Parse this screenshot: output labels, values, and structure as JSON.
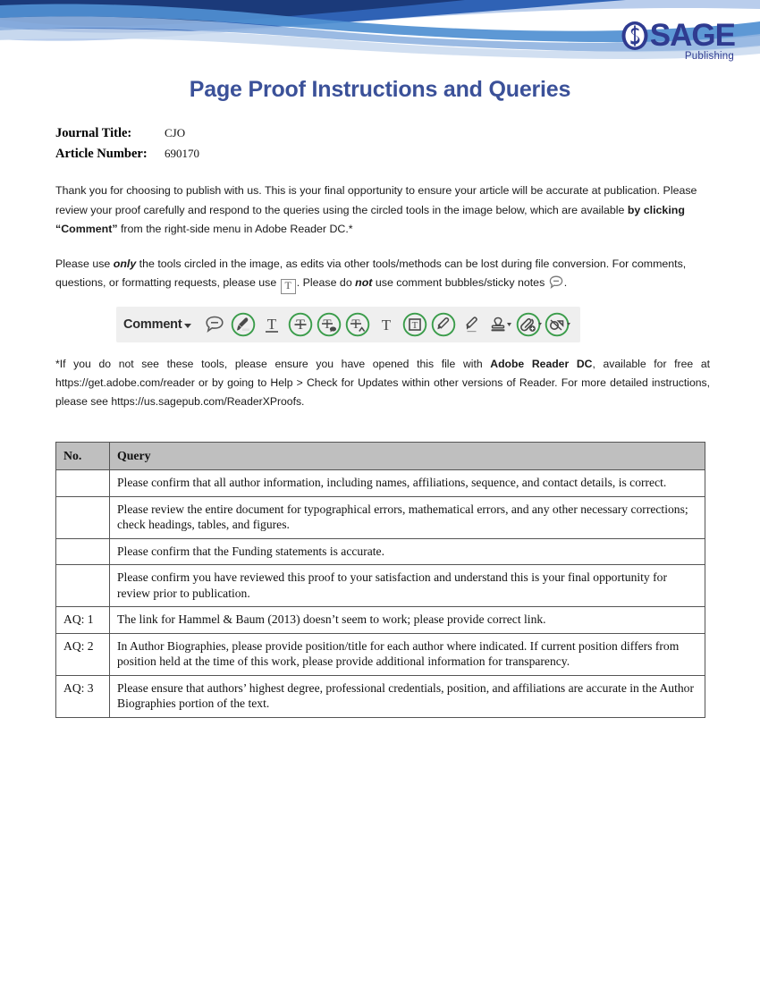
{
  "header": {
    "logo": {
      "word": "SAGE",
      "sub": "Publishing",
      "emblem_letter": "S",
      "color": "#2f3b90"
    },
    "banner_colors": [
      "#1b3a7a",
      "#2f62b5",
      "#4f8fd1",
      "#8fb3e0",
      "#b9cdec"
    ]
  },
  "title": "Page Proof Instructions and Queries",
  "title_color": "#3b5199",
  "meta": [
    {
      "label": "Journal Title:",
      "value": "CJO"
    },
    {
      "label": "Article Number:",
      "value": "690170"
    }
  ],
  "paragraph1": {
    "text_a": "Thank you for choosing to publish with us. This is your final opportunity to ensure your article will be accurate at publication. Please review your proof carefully and respond to the queries using the circled tools in the image below, which are available ",
    "bold_b": "by clicking “Comment”",
    "text_c": " from the right-side menu in Adobe Reader DC.*"
  },
  "paragraph2": {
    "text_a": "Please use ",
    "italic_b": "only",
    "text_c": " the tools circled in the image, as edits via other tools/methods can be lost during file conversion. For comments, questions, or formatting requests, please use ",
    "icon_tbox": "T",
    "text_d": ".  Please do ",
    "italic_e": "not",
    "text_f": " use comment bubbles/sticky notes ",
    "text_g": "."
  },
  "toolbar": {
    "label": "Comment",
    "caret": "dropdown-caret",
    "background": "#efefef",
    "ring_color": "#3a9c4a",
    "icon_color": "#4a4a4a",
    "tools": [
      {
        "name": "sticky-note-icon",
        "circled": false
      },
      {
        "name": "highlight-text-icon",
        "circled": true
      },
      {
        "name": "underline-text-icon",
        "circled": false
      },
      {
        "name": "strikethrough-text-icon",
        "circled": true
      },
      {
        "name": "replace-text-icon",
        "circled": true
      },
      {
        "name": "insert-text-icon",
        "circled": true
      },
      {
        "name": "add-text-icon",
        "circled": false
      },
      {
        "name": "text-box-icon",
        "circled": true
      },
      {
        "name": "draw-pencil-icon",
        "circled": true
      },
      {
        "name": "eraser-icon",
        "circled": false
      },
      {
        "name": "stamp-icon",
        "circled": false
      },
      {
        "name": "attach-file-icon",
        "circled": true
      },
      {
        "name": "drawing-tools-icon",
        "circled": true
      }
    ]
  },
  "footnote": {
    "text_a": "*If you do not see these tools, please ensure you have opened this file with ",
    "bold_b": "Adobe Reader DC",
    "text_c": ", available for free at https://get.adobe.com/reader or by going to Help > Check for Updates within other versions of Reader. For more detailed instructions, please see https://us.sagepub.com/ReaderXProofs."
  },
  "table": {
    "headers": [
      "No.",
      "Query"
    ],
    "rows": [
      {
        "no": "",
        "query": "Please confirm that all author information, including names, affiliations, sequence, and contact details, is correct."
      },
      {
        "no": "",
        "query": "Please review the entire document for typographical errors, mathematical errors, and any other necessary corrections; check headings, tables, and figures."
      },
      {
        "no": "",
        "query": "Please confirm that the Funding statements is accurate."
      },
      {
        "no": "",
        "query": "Please confirm you have reviewed this proof to your satisfaction and understand this is your final opportunity for review prior to publication."
      },
      {
        "no": "AQ: 1",
        "query": "The link for Hammel & Baum (2013) doesn’t seem to work; please provide correct link."
      },
      {
        "no": "AQ: 2",
        "query": "In Author Biographies, please provide position/title for each author where indicated. If current position differs from position held at the time of this work, please provide additional information for transparency."
      },
      {
        "no": "AQ: 3",
        "query": "Please ensure that authors’ highest degree, professional credentials, position, and affiliations are accurate in the Author Biographies portion of the text."
      }
    ]
  }
}
